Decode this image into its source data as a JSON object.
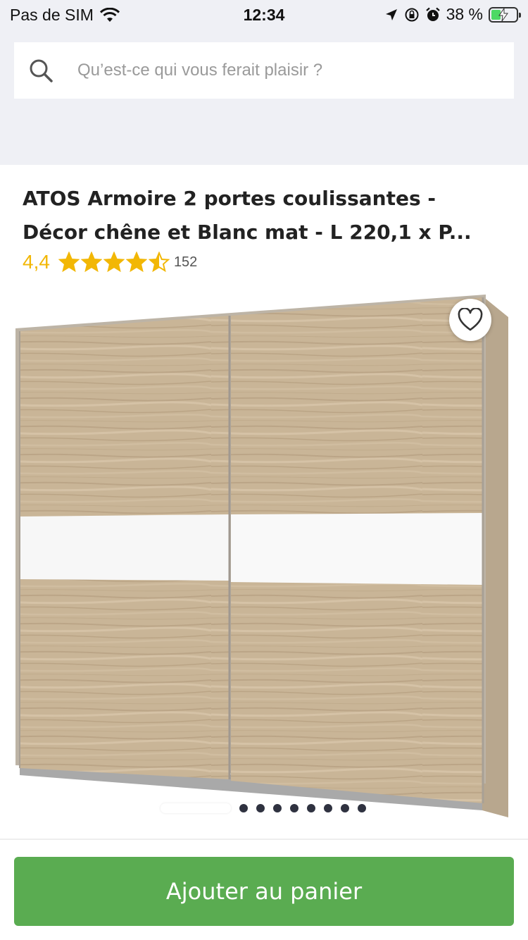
{
  "status_bar": {
    "carrier": "Pas de SIM",
    "time": "12:34",
    "battery_percent": "38 %",
    "battery_level": 0.38
  },
  "search": {
    "placeholder": "Qu’est-ce qui vous ferait plaisir ?"
  },
  "product": {
    "title": "ATOS Armoire 2 portes coulissantes - Décor chêne et Blanc mat - L 220,1 x P...",
    "rating": "4,4",
    "rating_value": 4.4,
    "review_count": "152"
  },
  "carousel": {
    "dot_count": 8
  },
  "actions": {
    "add_to_cart": "Ajouter au panier"
  },
  "colors": {
    "accent_green": "#5aac51",
    "star_yellow": "#f2b705"
  }
}
